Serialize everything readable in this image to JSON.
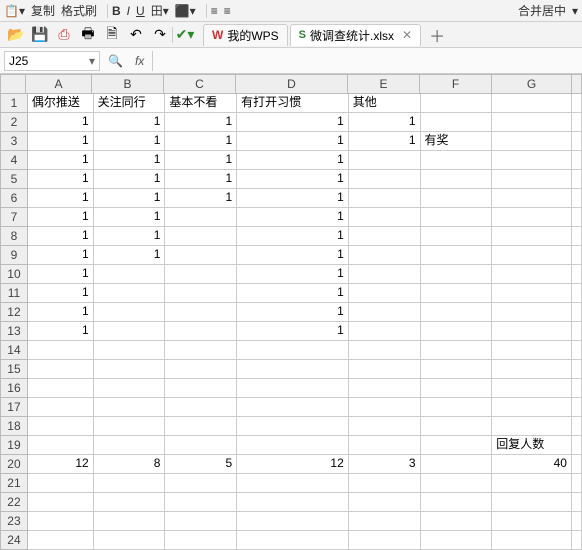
{
  "toolbar_top": {
    "copy": "复制",
    "format_painter": "格式刷",
    "b": "B",
    "i": "I",
    "u": "U",
    "merge_center": "合并居中"
  },
  "toolbar2": {
    "tab1": "我的WPS",
    "tab2": "微调查统计.xlsx"
  },
  "namebox": "J25",
  "fx_label": "fx",
  "columns": [
    "A",
    "B",
    "C",
    "D",
    "E",
    "F",
    "G"
  ],
  "headers": {
    "A": "偶尔推送",
    "B": "关注同行",
    "C": "基本不看",
    "D": "有打开习惯",
    "E": "其他"
  },
  "rows": {
    "2": {
      "A": "1",
      "B": "1",
      "C": "1",
      "D": "1",
      "E": "1"
    },
    "3": {
      "A": "1",
      "B": "1",
      "C": "1",
      "D": "1",
      "E": "1",
      "F": "有奖"
    },
    "4": {
      "A": "1",
      "B": "1",
      "C": "1",
      "D": "1"
    },
    "5": {
      "A": "1",
      "B": "1",
      "C": "1",
      "D": "1"
    },
    "6": {
      "A": "1",
      "B": "1",
      "C": "1",
      "D": "1"
    },
    "7": {
      "A": "1",
      "B": "1",
      "D": "1"
    },
    "8": {
      "A": "1",
      "B": "1",
      "D": "1"
    },
    "9": {
      "A": "1",
      "B": "1",
      "D": "1"
    },
    "10": {
      "A": "1",
      "D": "1"
    },
    "11": {
      "A": "1",
      "D": "1"
    },
    "12": {
      "A": "1",
      "D": "1"
    },
    "13": {
      "A": "1",
      "D": "1"
    },
    "19": {
      "G": "回复人数"
    },
    "20": {
      "A": "12",
      "B": "8",
      "C": "5",
      "D": "12",
      "E": "3",
      "G": "40"
    }
  },
  "row_count": 24
}
